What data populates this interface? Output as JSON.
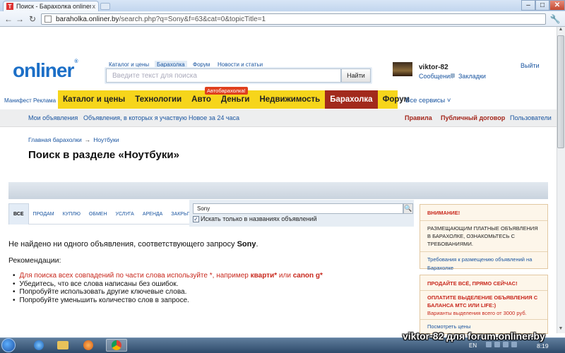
{
  "browser": {
    "tab_title": "Поиск - Барахолка onliner.by",
    "tab_close": "x",
    "window_min": "–",
    "window_max": "□",
    "window_close": "✕",
    "url_host": "baraholka.onliner.by",
    "url_path": "/search.php?q=Sony&f=63&cat=0&topicTitle=1"
  },
  "header": {
    "logo": "onliner",
    "logo_tm": "®",
    "top_links": [
      "Каталог и цены",
      "Барахолка",
      "Форум",
      "Новости и статьи"
    ],
    "search_placeholder": "Введите текст для поиска",
    "search_button": "Найти",
    "username": "viktor-82",
    "messages": "Сообщения",
    "bookmarks": "Закладки",
    "logout": "Выйти"
  },
  "side_links": [
    "Манифест",
    "Реклама"
  ],
  "main_nav": [
    {
      "label": "Каталог и цены",
      "active": false
    },
    {
      "label": "Технологии",
      "active": false
    },
    {
      "label": "Авто",
      "active": false
    },
    {
      "label": "Деньги",
      "active": false
    },
    {
      "label": "Недвижимость",
      "active": false
    },
    {
      "label": "Барахолка",
      "active": true
    },
    {
      "label": "Форум",
      "active": false
    }
  ],
  "avto_badge": "Автобарахолка!",
  "all_services": "Все сервисы ˅",
  "sub_nav": {
    "left": [
      "Мои объявления",
      "Объявления, в которых я участвую",
      "Новое за 24 часа"
    ],
    "right": [
      "Правила",
      "Публичный договор",
      "Пользователи"
    ]
  },
  "breadcrumb": {
    "home": "Главная барахолки",
    "arrow": "→",
    "current": "Ноутбуки"
  },
  "page_title": "Поиск в разделе «Ноутбуки»",
  "filter_tabs": [
    "ВСЕ",
    "ПРОДАМ",
    "КУПЛЮ",
    "ОБМЕН",
    "УСЛУГА",
    "АРЕНДА",
    "ЗАКРЫТО"
  ],
  "query": {
    "value": "Sony",
    "checkbox_checked": true,
    "checkbox_label": "Искать только в названиях объявлений"
  },
  "results": {
    "no_result_prefix": "Не найдено ни одного объявления, соответствующего запросу",
    "no_result_query": "Sony",
    "no_result_suffix": ".",
    "reco_title": "Рекомендации:",
    "tip1_a": "Для поиска всех совпадений по части слова используйте *, например",
    "tip1_b": "кварти*",
    "tip1_c": "или",
    "tip1_d": "canon g*",
    "tip2": "Убедитесь, что все слова написаны без ошибок.",
    "tip3": "Попробуйте использовать другие ключевые слова.",
    "tip4": "Попробуйте уменьшить количество слов в запросе."
  },
  "box1": {
    "title": "ВНИМАНИЕ!",
    "text": "РАЗМЕЩАЮЩИМ ПЛАТНЫЕ ОБЪЯВЛЕНИЯ В БАРАХОЛКЕ, ОЗНАКОМЬТЕСЬ С ТРЕБОВАНИЯМИ.",
    "link": "Требования к размещению объявлений на Барахолке"
  },
  "box2": {
    "title": "ПРОДАЙТЕ ВСЁ, ПРЯМО СЕЙЧАС!",
    "text": "ОПЛАТИТЕ ВЫДЕЛЕНИЕ ОБЪЯВЛЕНИЯ С БАЛАНСА МТС ИЛИ LIFE:)",
    "note": "Варианты выделения всего от 3000 руб.",
    "link": "Посмотреть цены"
  },
  "watermark": "viktor-82 для forum.onliner.by",
  "taskbar": {
    "lang": "EN",
    "time": "8:19"
  },
  "colors": {
    "brand_blue": "#1c6fc7",
    "nav_yellow": "#f6d51b",
    "active_red": "#a22a1c",
    "alert_red": "#c8281d"
  }
}
